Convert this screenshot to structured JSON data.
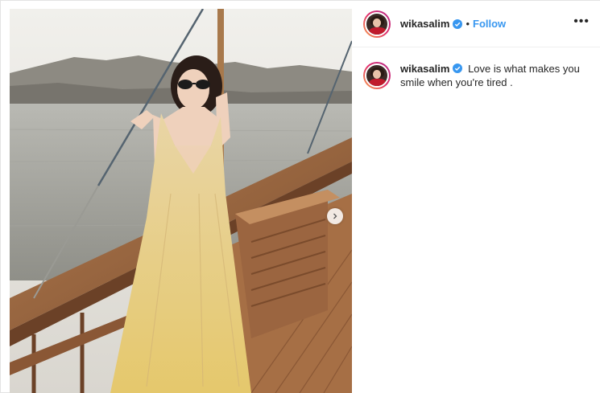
{
  "post": {
    "username": "wikasalim",
    "separator": "•",
    "follow_label": "Follow",
    "more_label": "•••",
    "caption": "Love is what makes you smile when you're tired ."
  },
  "colors": {
    "follow": "#3897f0",
    "verified": "#3897f0",
    "story_ring": [
      "#f9a44a",
      "#e1306c",
      "#b32a8a"
    ]
  },
  "icons": {
    "verified": "verified-badge-icon",
    "carousel_next": "chevron-right-icon"
  }
}
